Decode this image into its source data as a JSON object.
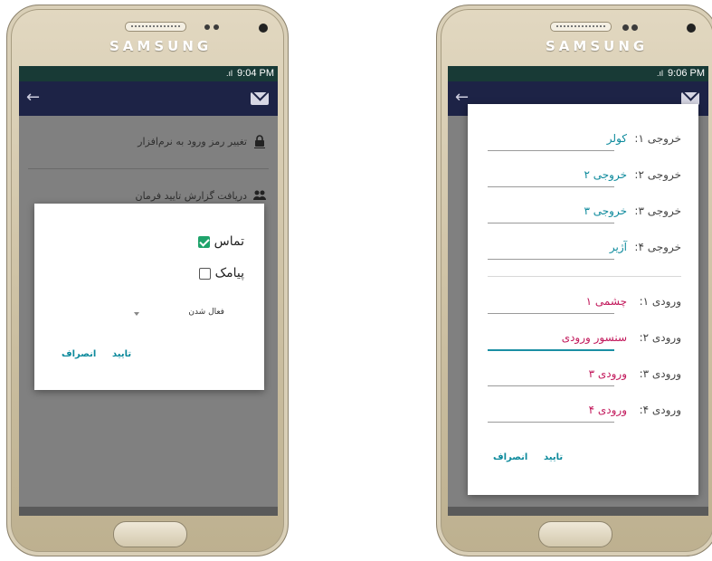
{
  "colors": {
    "status_bar": "#183a36",
    "toolbar": "#1d2346",
    "accent_teal": "#0d8a9c",
    "accent_pink": "#c2185b",
    "checkbox_on": "#1fa36b"
  },
  "left_phone": {
    "brand": "SAMSUNG",
    "status": {
      "signal": ".ıl",
      "time": "9:04 PM"
    },
    "toolbar": {
      "back_icon": "arrow-left-icon",
      "mail_icon": "envelope-icon"
    },
    "menu": [
      {
        "label": "تغییر رمز ورود به نرم‌افزار",
        "icon": "lock-icon"
      },
      {
        "label": "دریافت گزارش تایید فرمان",
        "icon": "users-icon"
      }
    ],
    "dialog": {
      "options": [
        {
          "label": "تماس",
          "checked": true
        },
        {
          "label": "پیامک",
          "checked": false
        }
      ],
      "spinner": {
        "value": "فعال شدن"
      },
      "confirm": "تایید",
      "cancel": "انصراف"
    }
  },
  "right_phone": {
    "brand": "SAMSUNG",
    "status": {
      "signal": ".ıl",
      "time": "9:06 PM"
    },
    "outputs": [
      {
        "label": "خروجی ۱:",
        "value": "کولر"
      },
      {
        "label": "خروجی ۲:",
        "value": "خروجی ۲"
      },
      {
        "label": "خروجی ۳:",
        "value": "خروجی ۳"
      },
      {
        "label": "خروجی ۴:",
        "value": "آژیر"
      }
    ],
    "inputs": [
      {
        "label": "ورودی ۱:",
        "value": "چشمی ۱"
      },
      {
        "label": "ورودی ۲:",
        "value": "سنسور ورودی"
      },
      {
        "label": "ورودی ۳:",
        "value": "ورودی ۳"
      },
      {
        "label": "ورودی ۴:",
        "value": "ورودی ۴"
      }
    ],
    "confirm": "تایید",
    "cancel": "انصراف"
  }
}
